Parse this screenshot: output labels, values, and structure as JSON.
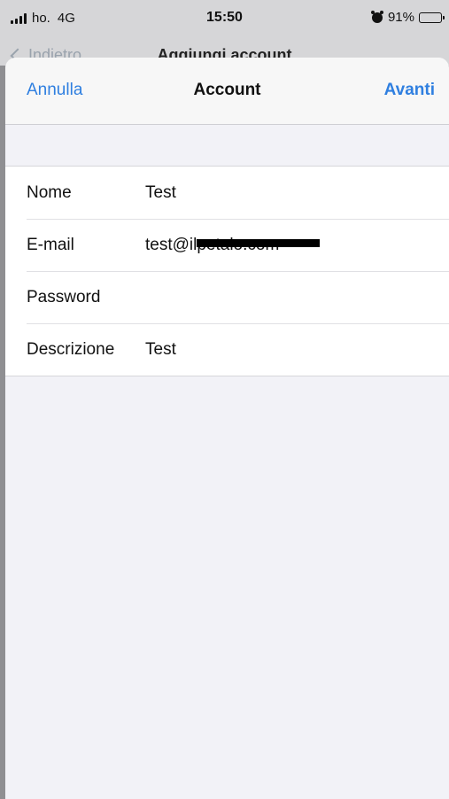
{
  "status_bar": {
    "carrier": "ho.",
    "network": "4G",
    "time": "15:50",
    "battery": "91%",
    "battery_level": 0.91
  },
  "background_page": {
    "back_label": "Indietro",
    "title": "Aggiungi account"
  },
  "nav": {
    "cancel_label": "Annulla",
    "title": "Account",
    "next_label": "Avanti"
  },
  "form": {
    "fields": [
      {
        "label": "Nome",
        "value": "Test"
      },
      {
        "label": "E-mail",
        "value": "test@ilpetalo.com"
      },
      {
        "label": "Password",
        "value": ""
      },
      {
        "label": "Descrizione",
        "value": "Test"
      }
    ]
  },
  "colors": {
    "accent": "#2f7fe0",
    "background": "#f2f2f7"
  }
}
